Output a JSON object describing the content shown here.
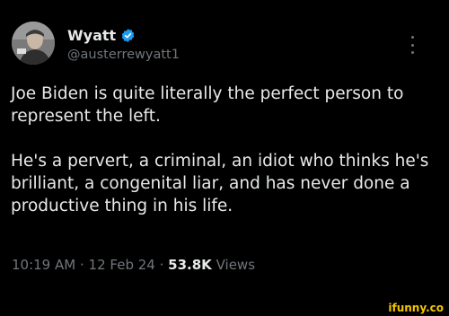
{
  "author": {
    "display_name": "Wyatt",
    "handle": "@austerrewyatt1",
    "verified": true
  },
  "tweet": {
    "paragraphs": [
      "Joe Biden is quite literally the perfect person to represent the left.",
      "He's a pervert, a criminal, an idiot who thinks he's brilliant, a congenital liar, and has never done a productive thing in his life."
    ],
    "time": "10:19 AM",
    "date": "12 Feb 24",
    "views_count": "53.8K",
    "views_label": "Views",
    "separator": "·"
  },
  "icons": {
    "verified": "verified-badge-icon",
    "more": "more-options-icon"
  },
  "colors": {
    "background": "#000000",
    "primary_text": "#e7e9ea",
    "secondary_text": "#71767b",
    "verified_blue": "#1d9bf0",
    "watermark": "#f4c400"
  },
  "watermark": "ifunny.co"
}
